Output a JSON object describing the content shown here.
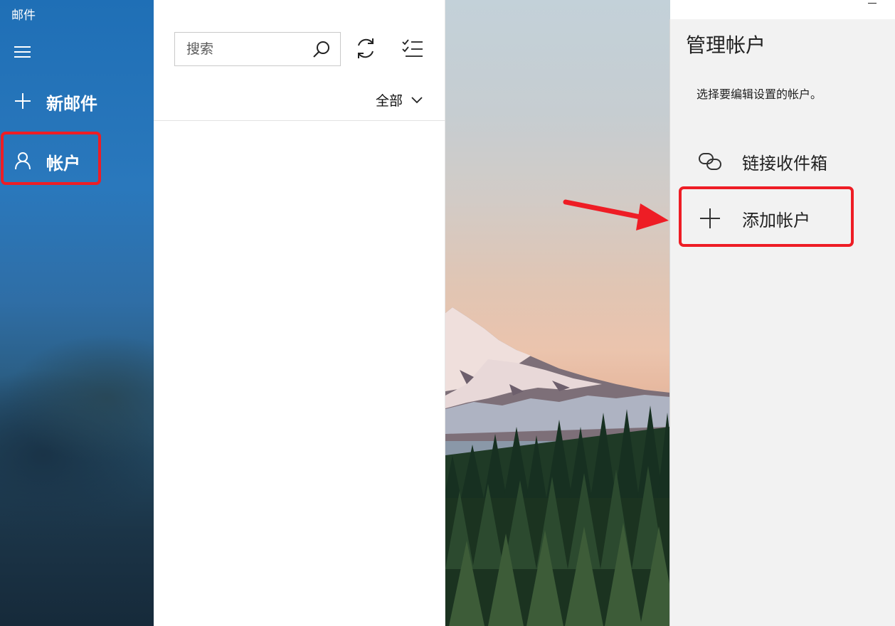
{
  "app": {
    "title": "邮件"
  },
  "nav": {
    "new_mail_label": "新邮件",
    "accounts_label": "帐户"
  },
  "list": {
    "search_placeholder": "搜索",
    "filter_label": "全部"
  },
  "flyout": {
    "title": "管理帐户",
    "subtitle": "选择要编辑设置的帐户。",
    "items": [
      {
        "label": "链接收件箱",
        "icon": "link-icon"
      },
      {
        "label": "添加帐户",
        "icon": "plus-icon"
      }
    ]
  },
  "colors": {
    "nav_blue": "#1f6fb6",
    "highlight_red": "#ee1d25",
    "flyout_bg": "#f2f2f2"
  }
}
